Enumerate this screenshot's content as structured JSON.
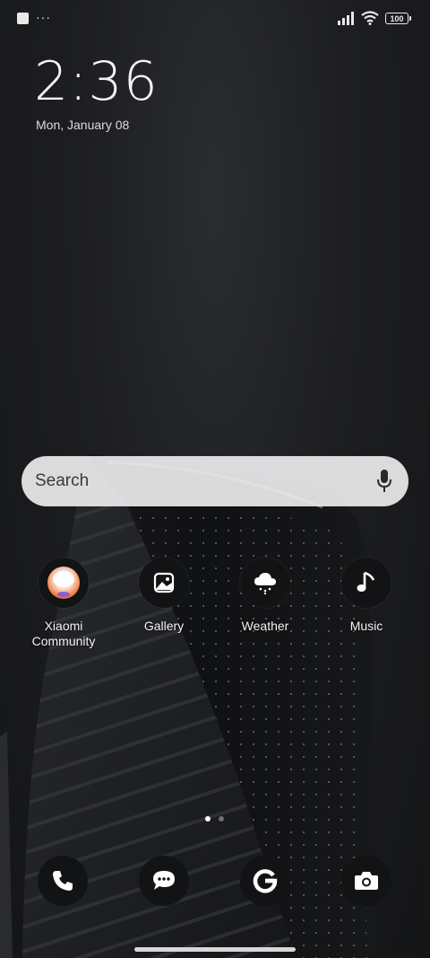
{
  "status_bar": {
    "dots": "···",
    "battery_level": "100",
    "signal_icon": "signal-bars-icon",
    "wifi_icon": "wifi-icon"
  },
  "clock": {
    "time": "2:36",
    "date": "Mon, January 08"
  },
  "search": {
    "placeholder": "Search",
    "mic_icon": "microphone-icon"
  },
  "apps": [
    {
      "label": "Xiaomi\nCommunity",
      "icon": "xiaomi-community-icon"
    },
    {
      "label": "Gallery",
      "icon": "gallery-icon"
    },
    {
      "label": "Weather",
      "icon": "weather-icon"
    },
    {
      "label": "Music",
      "icon": "music-icon"
    }
  ],
  "page_indicator": {
    "pages": 2,
    "current": 1
  },
  "dock": [
    {
      "icon": "phone-icon"
    },
    {
      "icon": "messages-icon"
    },
    {
      "icon": "google-icon"
    },
    {
      "icon": "camera-icon"
    }
  ],
  "colors": {
    "background": "#1a1b1d",
    "search_bg": "#ebebed",
    "icon_bg": "#121314",
    "text": "#ffffff"
  }
}
